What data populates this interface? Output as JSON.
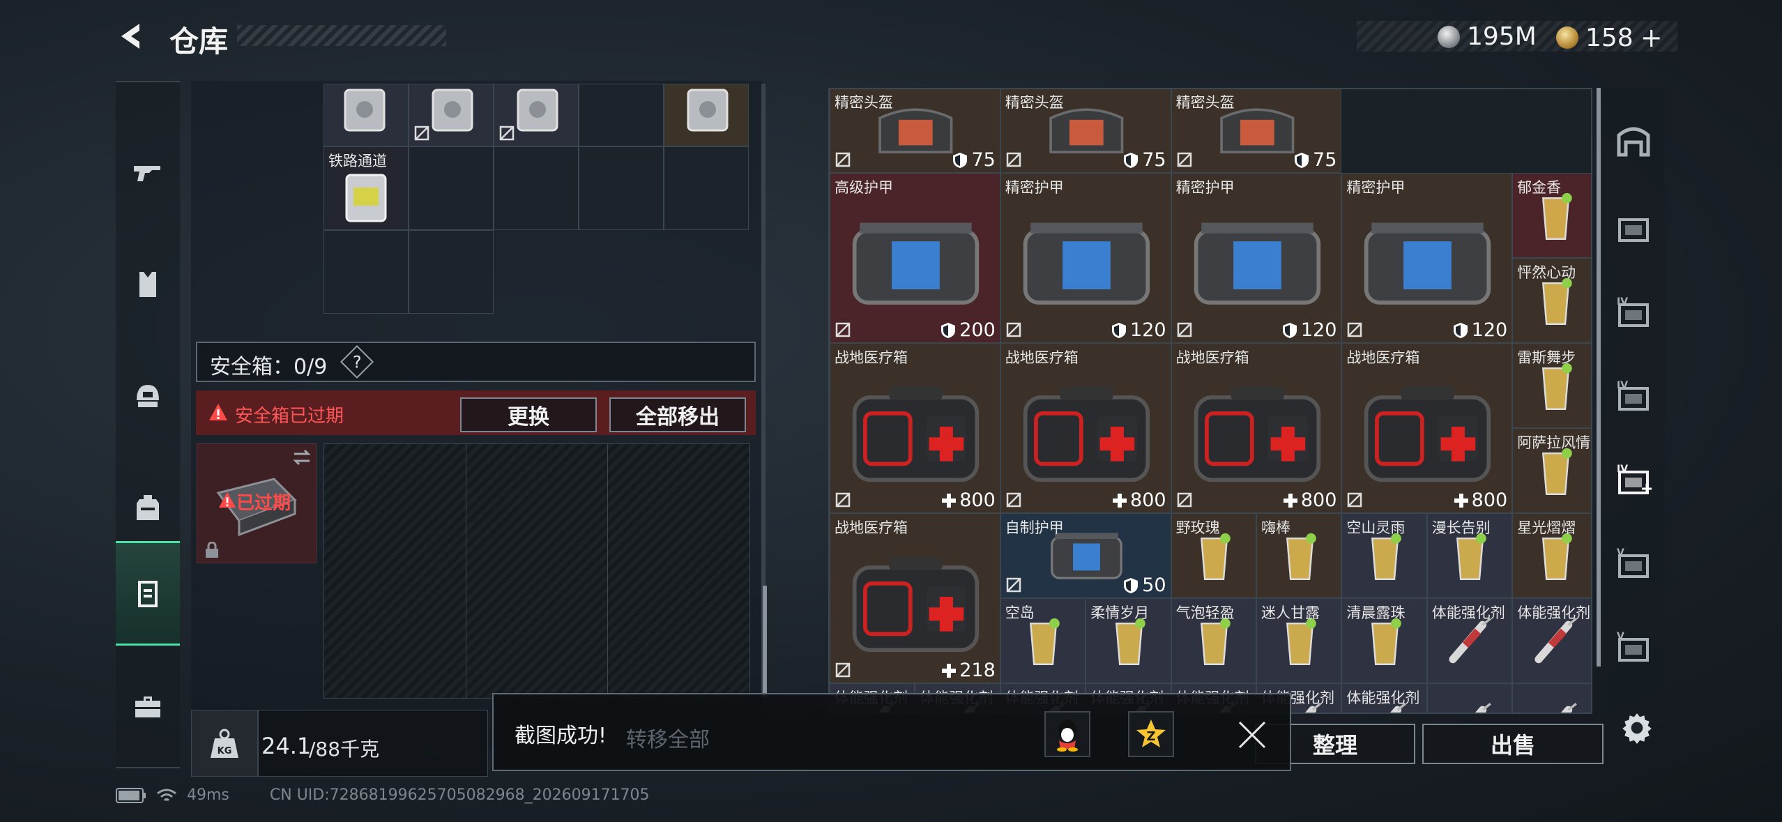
{
  "header": {
    "title": "仓库",
    "currency_silver": "195M",
    "currency_gold": "158"
  },
  "left_nav": [
    {
      "icon": "gun-icon"
    },
    {
      "icon": "vest-icon"
    },
    {
      "icon": "helmet-icon"
    },
    {
      "icon": "backpack-icon"
    },
    {
      "icon": "safebox-icon",
      "active": true
    },
    {
      "icon": "briefcase-icon"
    }
  ],
  "stash": {
    "item_label": "铁路通道"
  },
  "safebox": {
    "label": "安全箱：0/9",
    "help": "?",
    "expired_warning": "安全箱已过期",
    "replace_button": "更换",
    "move_all_out_button": "全部移出",
    "expired_label": "已过期"
  },
  "bottom_bar": {
    "weight": "24.1",
    "weight_total": "/88千克",
    "transfer_all": "转移全部",
    "sort": "整理",
    "sell": "出售"
  },
  "status_bar": {
    "ping": "49ms",
    "uid": "CN UID:7286819962570508296​8_202609171705"
  },
  "toast": {
    "message": "截图成功!"
  },
  "warehouse_items": [
    {
      "name": "精密头盔",
      "value": "75",
      "vt": "shield"
    },
    {
      "name": "精密头盔",
      "value": "75",
      "vt": "shield"
    },
    {
      "name": "精密头盔",
      "value": "75",
      "vt": "shield"
    },
    {
      "name": "高级护甲",
      "value": "200",
      "vt": "shield"
    },
    {
      "name": "精密护甲",
      "value": "120",
      "vt": "shield"
    },
    {
      "name": "精密护甲",
      "value": "120",
      "vt": "shield"
    },
    {
      "name": "精密护甲",
      "value": "120",
      "vt": "shield"
    },
    {
      "name": "郁金香"
    },
    {
      "name": "战地医疗箱",
      "value": "800",
      "vt": "plus"
    },
    {
      "name": "战地医疗箱",
      "value": "800",
      "vt": "plus"
    },
    {
      "name": "战地医疗箱",
      "value": "800",
      "vt": "plus"
    },
    {
      "name": "战地医疗箱",
      "value": "800",
      "vt": "plus"
    },
    {
      "name": "怦然心动"
    },
    {
      "name": "雷斯舞步"
    },
    {
      "name": "阿萨拉风情"
    },
    {
      "name": "战地医疗箱",
      "value": "218",
      "vt": "plus"
    },
    {
      "name": "自制护甲",
      "value": "50",
      "vt": "shield"
    },
    {
      "name": "野玫瑰"
    },
    {
      "name": "嗨棒"
    },
    {
      "name": "空山灵雨"
    },
    {
      "name": "漫长告别"
    },
    {
      "name": "星光熠熠"
    },
    {
      "name": "空岛"
    },
    {
      "name": "柔情岁月"
    },
    {
      "name": "气泡轻盈"
    },
    {
      "name": "迷人甘露"
    },
    {
      "name": "清晨露珠"
    },
    {
      "name": "体能强化剂"
    },
    {
      "name": "体能强化剂"
    },
    {
      "name": "体能强化剂"
    },
    {
      "name": "体能强化剂"
    },
    {
      "name": "体能强化剂"
    },
    {
      "name": "体能强化剂"
    },
    {
      "name": "体能强化剂"
    },
    {
      "name": "体能强化剂"
    },
    {
      "name": "体能强化剂"
    }
  ],
  "right_nav": [
    {
      "icon": "home-safe-icon"
    },
    {
      "icon": "stash-tab-icon"
    },
    {
      "icon": "stash-tab-iv-1-icon",
      "text": "IV"
    },
    {
      "icon": "stash-tab-iv-2-icon",
      "text": "IV"
    },
    {
      "icon": "stash-tab-iv-add-icon",
      "text": "IV"
    },
    {
      "icon": "stash-tab-v-1-icon",
      "text": "V"
    },
    {
      "icon": "stash-tab-v-2-icon",
      "text": "V"
    }
  ]
}
